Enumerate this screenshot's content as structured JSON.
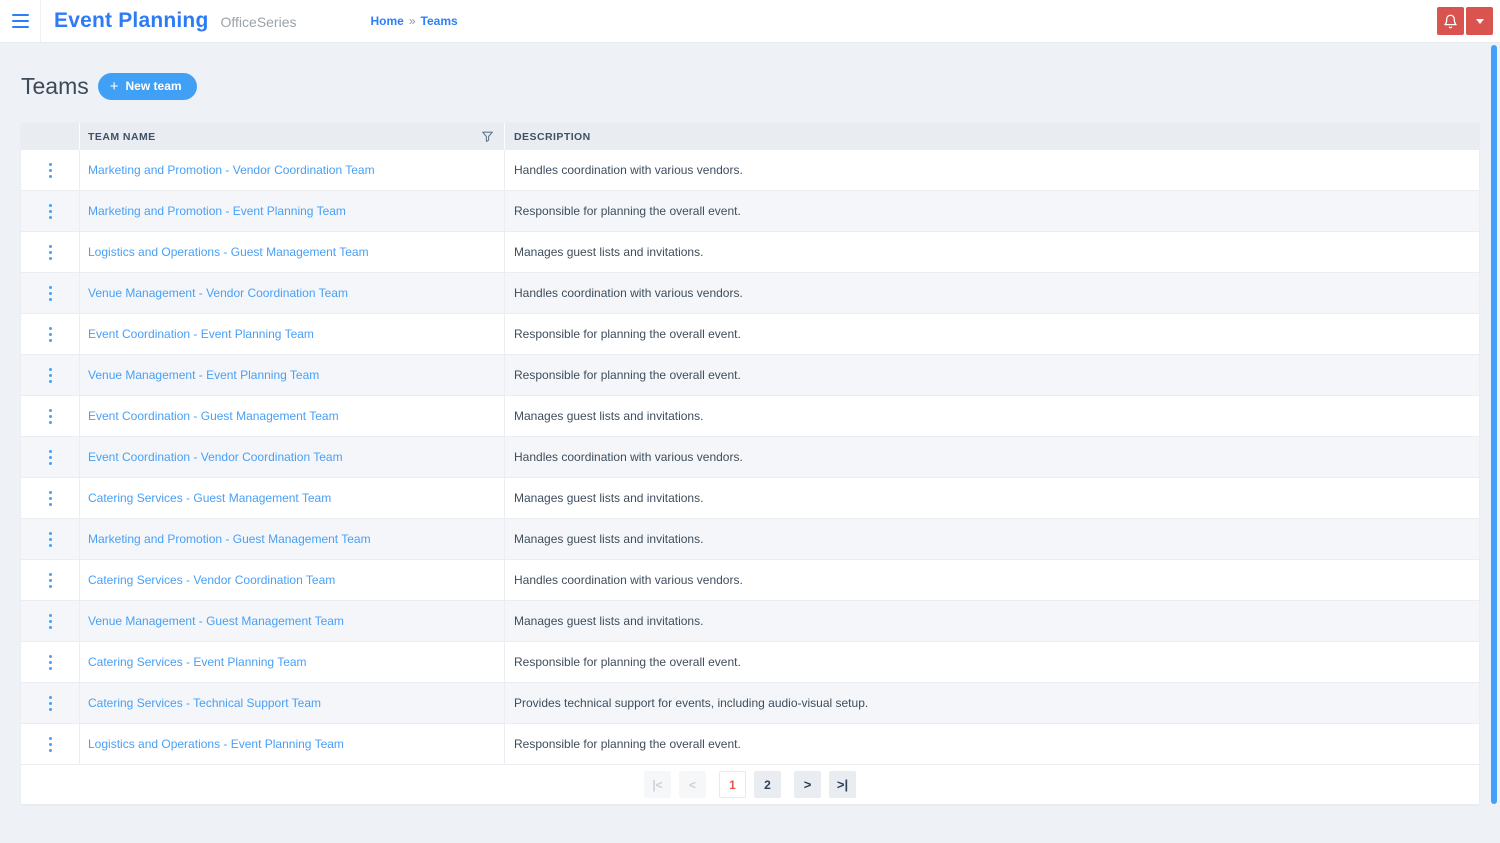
{
  "topbar": {
    "title": "Event Planning",
    "subtitle": "OfficeSeries",
    "breadcrumb": {
      "home": "Home",
      "separator": "»",
      "current": "Teams"
    }
  },
  "page": {
    "title": "Teams",
    "new_team_button": "New team",
    "new_team_plus": "+"
  },
  "table": {
    "columns": {
      "team_name": "TEAM NAME",
      "description": "DESCRIPTION"
    },
    "rows": [
      {
        "name": "Marketing and Promotion - Vendor Coordination Team",
        "description": "Handles coordination with various vendors."
      },
      {
        "name": "Marketing and Promotion - Event Planning Team",
        "description": "Responsible for planning the overall event."
      },
      {
        "name": "Logistics and Operations - Guest Management Team",
        "description": "Manages guest lists and invitations."
      },
      {
        "name": "Venue Management - Vendor Coordination Team",
        "description": "Handles coordination with various vendors."
      },
      {
        "name": "Event Coordination - Event Planning Team",
        "description": "Responsible for planning the overall event."
      },
      {
        "name": "Venue Management - Event Planning Team",
        "description": "Responsible for planning the overall event."
      },
      {
        "name": "Event Coordination - Guest Management Team",
        "description": "Manages guest lists and invitations."
      },
      {
        "name": "Event Coordination - Vendor Coordination Team",
        "description": "Handles coordination with various vendors."
      },
      {
        "name": "Catering Services - Guest Management Team",
        "description": "Manages guest lists and invitations."
      },
      {
        "name": "Marketing and Promotion - Guest Management Team",
        "description": "Manages guest lists and invitations."
      },
      {
        "name": "Catering Services - Vendor Coordination Team",
        "description": "Handles coordination with various vendors."
      },
      {
        "name": "Venue Management - Guest Management Team",
        "description": "Manages guest lists and invitations."
      },
      {
        "name": "Catering Services - Event Planning Team",
        "description": "Responsible for planning the overall event."
      },
      {
        "name": "Catering Services - Technical Support Team",
        "description": "Provides technical support for events, including audio-visual setup."
      },
      {
        "name": "Logistics and Operations - Event Planning Team",
        "description": "Responsible for planning the overall event."
      }
    ]
  },
  "pagination": {
    "first": "|<",
    "prev": "<",
    "pages": [
      "1",
      "2"
    ],
    "current_page": "1",
    "next": ">",
    "last": ">|"
  },
  "colors": {
    "accent_blue": "#2e7bf6",
    "link_blue": "#49a0f6",
    "button_blue": "#3fa0f6",
    "danger_red": "#d9534f",
    "active_page_red": "#e05b4a",
    "scrollbar_blue": "#42a0fb",
    "header_row_bg": "#e9edf2",
    "stripe_row_bg": "#f4f6f9"
  }
}
